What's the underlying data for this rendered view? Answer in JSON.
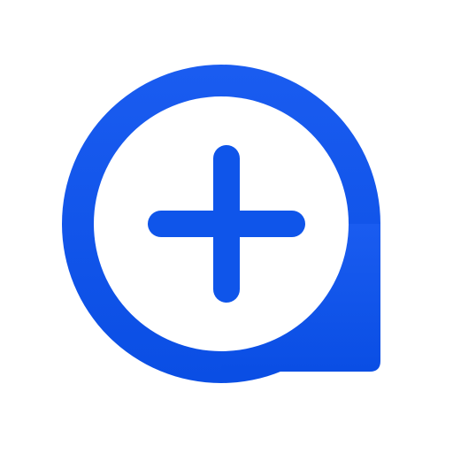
{
  "icon": {
    "name": "add-chat-bubble-icon",
    "description_symbol": "plus",
    "colors": {
      "background": "#ffffff",
      "bubble_top": "#1a5cf0",
      "bubble_bottom": "#0a4ee4",
      "inner_fill": "#ffffff",
      "plus": "#0f55ea"
    }
  }
}
